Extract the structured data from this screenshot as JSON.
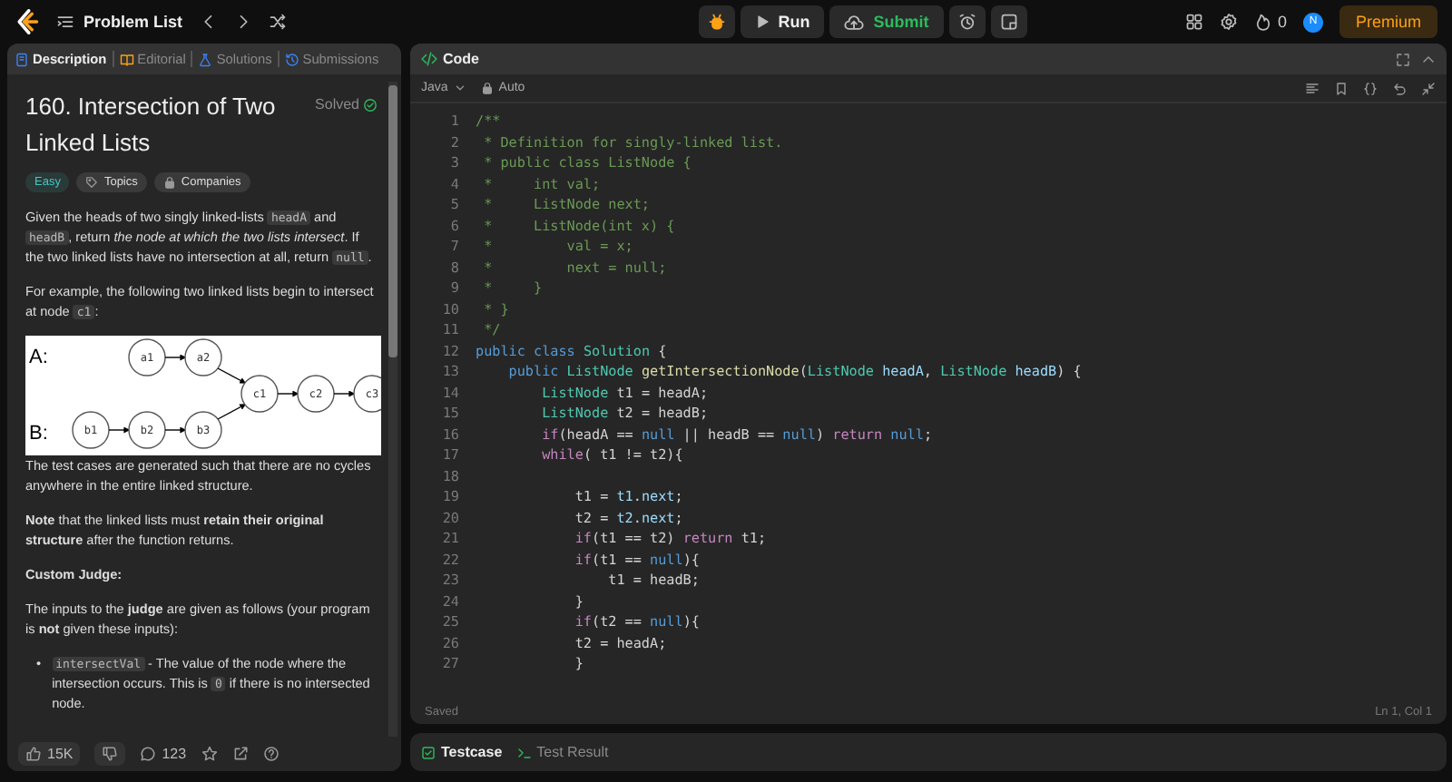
{
  "top_bar": {
    "problem_list": "Problem List",
    "run": "Run",
    "submit": "Submit",
    "streak_count": "0",
    "avatar_initial": "N",
    "premium": "Premium"
  },
  "description_panel": {
    "tabs": [
      {
        "label": "Description",
        "selected": true
      },
      {
        "label": "Editorial",
        "selected": false
      },
      {
        "label": "Solutions",
        "selected": false
      },
      {
        "label": "Submissions",
        "selected": false
      }
    ],
    "title": "160. Intersection of Two Linked Lists",
    "status": "Solved",
    "tags": [
      {
        "label": "Easy",
        "kind": "difficulty"
      },
      {
        "label": "Topics",
        "kind": "topics"
      },
      {
        "label": "Companies",
        "kind": "companies"
      }
    ],
    "content": [
      {
        "kind": "paragraph",
        "segments": [
          {
            "kind": "text",
            "text": "Given the heads of two singly linked-lists "
          },
          {
            "kind": "code",
            "text": "headA"
          },
          {
            "kind": "text",
            "text": " and "
          },
          {
            "kind": "code",
            "text": "headB"
          },
          {
            "kind": "text",
            "text": ", return "
          },
          {
            "kind": "italic",
            "text": "the node at which the two lists intersect"
          },
          {
            "kind": "text",
            "text": ". If the two linked lists have no intersection at all, return "
          },
          {
            "kind": "code",
            "text": "null"
          },
          {
            "kind": "text",
            "text": "."
          }
        ]
      },
      {
        "kind": "paragraph",
        "segments": [
          {
            "kind": "text",
            "text": "For example, the following two linked lists begin to intersect at node "
          },
          {
            "kind": "code",
            "text": "c1"
          },
          {
            "kind": "text",
            "text": ":"
          }
        ]
      },
      {
        "kind": "diagram",
        "list_a_label": "A:",
        "list_b_label": "B:",
        "list_a": [
          "a1",
          "a2"
        ],
        "list_b": [
          "b1",
          "b2",
          "b3"
        ],
        "shared": [
          "c1",
          "c2",
          "c3"
        ]
      },
      {
        "kind": "paragraph",
        "segments": [
          {
            "kind": "text",
            "text": "The test cases are generated such that there are no cycles anywhere in the entire linked structure."
          }
        ]
      },
      {
        "kind": "paragraph",
        "segments": [
          {
            "kind": "bold",
            "text": "Note"
          },
          {
            "kind": "text",
            "text": " that the linked lists must "
          },
          {
            "kind": "bold",
            "text": "retain their original structure"
          },
          {
            "kind": "text",
            "text": " after the function returns."
          }
        ]
      },
      {
        "kind": "paragraph",
        "segments": [
          {
            "kind": "bold",
            "text": "Custom Judge:"
          }
        ]
      },
      {
        "kind": "paragraph",
        "segments": [
          {
            "kind": "text",
            "text": "The inputs to the "
          },
          {
            "kind": "bold",
            "text": "judge"
          },
          {
            "kind": "text",
            "text": " are given as follows (your program is "
          },
          {
            "kind": "bold",
            "text": "not"
          },
          {
            "kind": "text",
            "text": " given these inputs):"
          }
        ]
      },
      {
        "kind": "bullet",
        "marker": "•",
        "segments": [
          {
            "kind": "code",
            "text": "intersectVal"
          },
          {
            "kind": "text",
            "text": " - The value of the node where the intersection occurs. This is "
          },
          {
            "kind": "code",
            "text": "0"
          },
          {
            "kind": "text",
            "text": " if there is no intersected node."
          }
        ]
      }
    ],
    "likes": "15K",
    "comments": "123"
  },
  "code_panel": {
    "tab": "Code",
    "language": "Java",
    "mode": "Auto",
    "lines": [
      {
        "number": "1",
        "tokens": [
          {
            "kind": "comment",
            "text": "/**"
          }
        ]
      },
      {
        "number": "2",
        "tokens": [
          {
            "kind": "comment",
            "text": " * Definition for singly-linked list."
          }
        ]
      },
      {
        "number": "3",
        "tokens": [
          {
            "kind": "comment",
            "text": " * public class ListNode {"
          }
        ]
      },
      {
        "number": "4",
        "tokens": [
          {
            "kind": "comment",
            "text": " *     int val;"
          }
        ]
      },
      {
        "number": "5",
        "tokens": [
          {
            "kind": "comment",
            "text": " *     ListNode next;"
          }
        ]
      },
      {
        "number": "6",
        "tokens": [
          {
            "kind": "comment",
            "text": " *     ListNode(int x) {"
          }
        ]
      },
      {
        "number": "7",
        "tokens": [
          {
            "kind": "comment",
            "text": " *         val = x;"
          }
        ]
      },
      {
        "number": "8",
        "tokens": [
          {
            "kind": "comment",
            "text": " *         next = null;"
          }
        ]
      },
      {
        "number": "9",
        "tokens": [
          {
            "kind": "comment",
            "text": " *     }"
          }
        ]
      },
      {
        "number": "10",
        "tokens": [
          {
            "kind": "comment",
            "text": " * }"
          }
        ]
      },
      {
        "number": "11",
        "tokens": [
          {
            "kind": "comment",
            "text": " */"
          }
        ]
      },
      {
        "number": "12",
        "tokens": [
          {
            "kind": "keyword",
            "text": "public class "
          },
          {
            "kind": "type",
            "text": "Solution"
          },
          {
            "kind": "plain",
            "text": " {"
          }
        ]
      },
      {
        "number": "13",
        "tokens": [
          {
            "kind": "keyword",
            "text": "    public "
          },
          {
            "kind": "type",
            "text": "ListNode "
          },
          {
            "kind": "function",
            "text": "getIntersectionNode"
          },
          {
            "kind": "plain",
            "text": "("
          },
          {
            "kind": "type",
            "text": "ListNode "
          },
          {
            "kind": "variable",
            "text": "headA"
          },
          {
            "kind": "plain",
            "text": ", "
          },
          {
            "kind": "type",
            "text": "ListNode "
          },
          {
            "kind": "variable",
            "text": "headB"
          },
          {
            "kind": "plain",
            "text": ") {"
          }
        ]
      },
      {
        "number": "14",
        "tokens": [
          {
            "kind": "type",
            "text": "        ListNode "
          },
          {
            "kind": "plain",
            "text": "t1 = headA;"
          }
        ]
      },
      {
        "number": "15",
        "tokens": [
          {
            "kind": "type",
            "text": "        ListNode "
          },
          {
            "kind": "plain",
            "text": "t2 = headB;"
          }
        ]
      },
      {
        "number": "16",
        "tokens": [
          {
            "kind": "control",
            "text": "        if"
          },
          {
            "kind": "plain",
            "text": "(headA == "
          },
          {
            "kind": "null",
            "text": "null"
          },
          {
            "kind": "plain",
            "text": " || headB == "
          },
          {
            "kind": "null",
            "text": "null"
          },
          {
            "kind": "plain",
            "text": ") "
          },
          {
            "kind": "control",
            "text": "return "
          },
          {
            "kind": "null",
            "text": "null"
          },
          {
            "kind": "plain",
            "text": ";"
          }
        ]
      },
      {
        "number": "17",
        "tokens": [
          {
            "kind": "control",
            "text": "        while"
          },
          {
            "kind": "plain",
            "text": "( t1 != t2){"
          }
        ]
      },
      {
        "number": "18"
      },
      {
        "number": "19",
        "tokens": [
          {
            "kind": "plain",
            "text": "            t1 = "
          },
          {
            "kind": "variable",
            "text": "t1"
          },
          {
            "kind": "plain",
            "text": "."
          },
          {
            "kind": "variable",
            "text": "next"
          },
          {
            "kind": "plain",
            "text": ";"
          }
        ]
      },
      {
        "number": "20",
        "tokens": [
          {
            "kind": "plain",
            "text": "            t2 = "
          },
          {
            "kind": "variable",
            "text": "t2"
          },
          {
            "kind": "plain",
            "text": "."
          },
          {
            "kind": "variable",
            "text": "next"
          },
          {
            "kind": "plain",
            "text": ";"
          }
        ]
      },
      {
        "number": "21",
        "tokens": [
          {
            "kind": "control",
            "text": "            if"
          },
          {
            "kind": "plain",
            "text": "(t1 == t2) "
          },
          {
            "kind": "control",
            "text": "return"
          },
          {
            "kind": "plain",
            "text": " t1;"
          }
        ]
      },
      {
        "number": "22",
        "tokens": [
          {
            "kind": "control",
            "text": "            if"
          },
          {
            "kind": "plain",
            "text": "(t1 == "
          },
          {
            "kind": "null",
            "text": "null"
          },
          {
            "kind": "plain",
            "text": "){"
          }
        ]
      },
      {
        "number": "23",
        "tokens": [
          {
            "kind": "plain",
            "text": "                t1 = headB;"
          }
        ]
      },
      {
        "number": "24",
        "tokens": [
          {
            "kind": "plain",
            "text": "            }"
          }
        ]
      },
      {
        "number": "25",
        "tokens": [
          {
            "kind": "control",
            "text": "            if"
          },
          {
            "kind": "plain",
            "text": "(t2 == "
          },
          {
            "kind": "null",
            "text": "null"
          },
          {
            "kind": "plain",
            "text": "){"
          }
        ]
      },
      {
        "number": "26",
        "tokens": [
          {
            "kind": "plain",
            "text": "            t2 = headA;"
          }
        ]
      },
      {
        "number": "27",
        "tokens": [
          {
            "kind": "plain",
            "text": "            }"
          }
        ]
      }
    ],
    "status": "Saved",
    "cursor": "Ln 1, Col 1"
  },
  "bottom_panel": {
    "tabs": [
      {
        "label": "Testcase",
        "selected": true
      },
      {
        "label": "Test Result",
        "selected": false
      }
    ]
  }
}
